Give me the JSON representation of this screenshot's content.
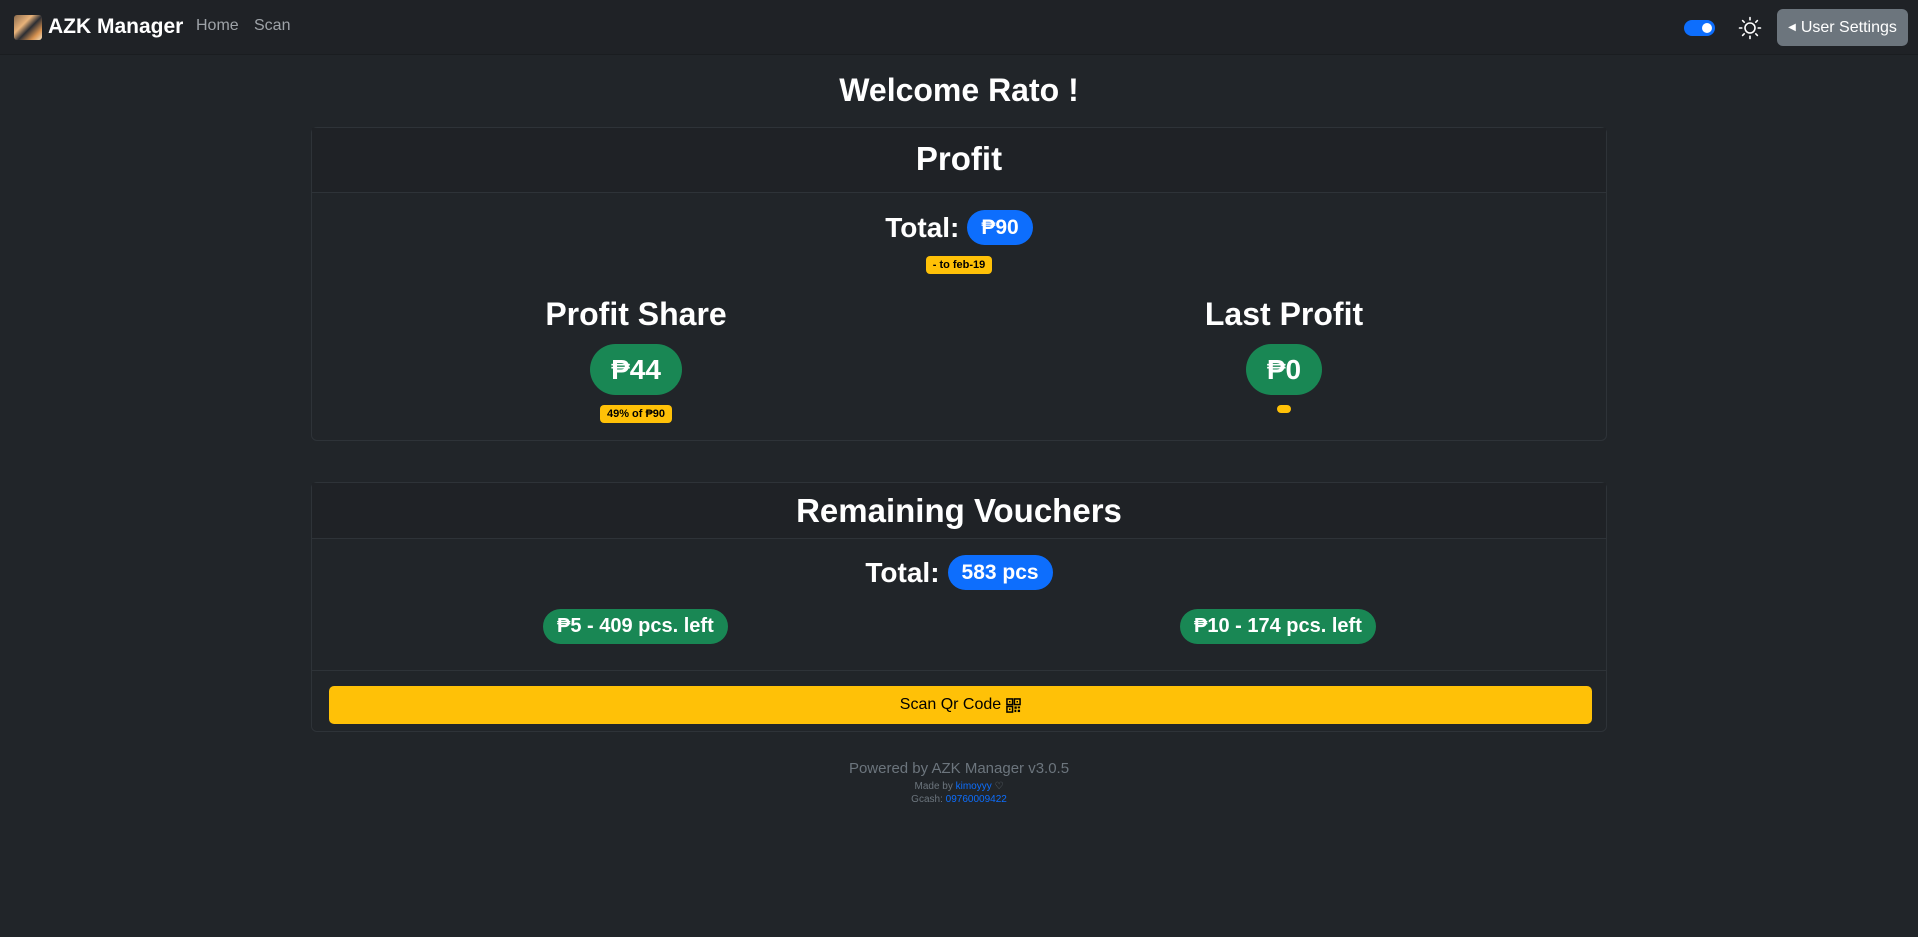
{
  "navbar": {
    "brand": "AZK Manager",
    "links": [
      "Home",
      "Scan"
    ],
    "theme_toggle_on": true,
    "theme_icon": "sun-icon",
    "settings_label": "User Settings",
    "settings_icon": "caret-left-icon"
  },
  "welcome": "Welcome Rato !",
  "profit": {
    "header": "Profit",
    "total_label": "Total:",
    "total_value": "₱90",
    "date_range": "- to feb-19",
    "share_title": "Profit Share",
    "share_value": "₱44",
    "share_note": "49% of ₱90",
    "last_title": "Last Profit",
    "last_value": "₱0",
    "last_note": ""
  },
  "vouchers": {
    "header": "Remaining Vouchers",
    "total_label": "Total:",
    "total_value": "583 pcs",
    "items": [
      "₱5 - 409 pcs. left",
      "₱10 - 174 pcs. left"
    ],
    "scan_label": "Scan Qr Code",
    "scan_icon": "qr-code-icon"
  },
  "footer": {
    "powered": "Powered by AZK Manager v3.0.5",
    "made_by_label": "Made by",
    "made_by_name": "kimoyyy",
    "heart": "♡",
    "gcash_label": "Gcash:",
    "gcash_number": "09760009422"
  },
  "colors": {
    "background": "#212529",
    "primary": "#0d6efd",
    "success": "#198754",
    "warning": "#ffc107",
    "secondary": "#6c757d"
  }
}
